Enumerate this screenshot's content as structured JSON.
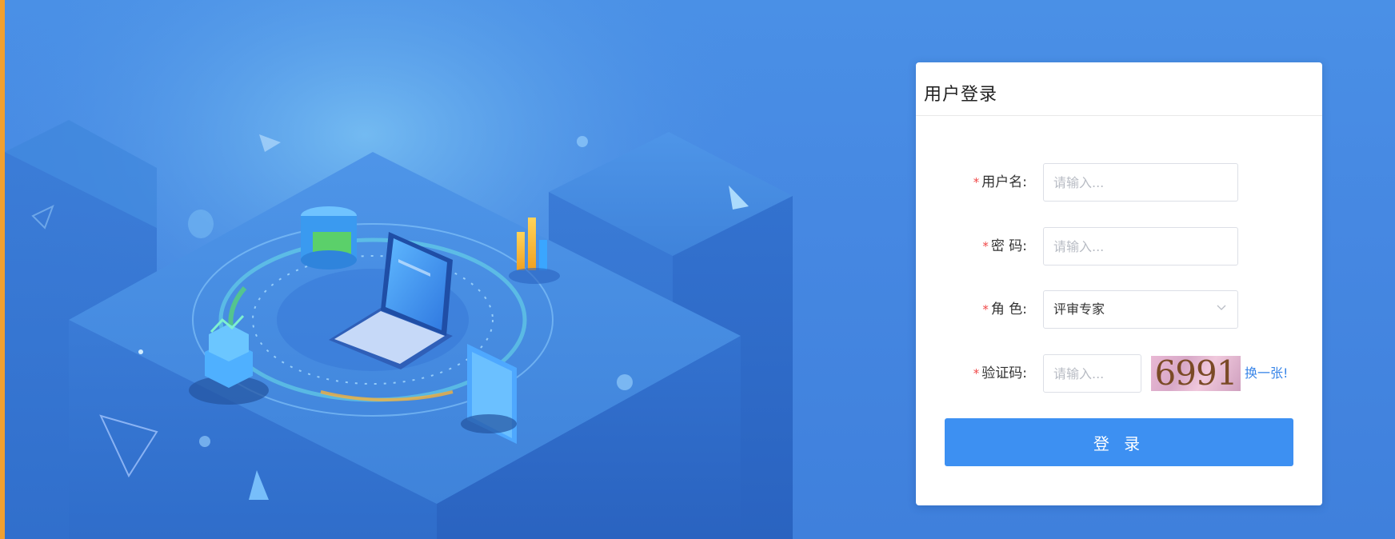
{
  "login": {
    "title": "用户登录",
    "username": {
      "label": "用户名:",
      "placeholder": "请输入..."
    },
    "password": {
      "label": "密 码:",
      "placeholder": "请输入..."
    },
    "role": {
      "label": "角 色:",
      "value": "评审专家"
    },
    "captcha": {
      "label": "验证码:",
      "placeholder": "请输入...",
      "code": "6991",
      "refresh_label": "换一张!"
    },
    "submit_label": "登 录",
    "required_mark": "*"
  },
  "colors": {
    "background": "#4688e2",
    "accent": "#3d90f2",
    "required": "#f04848",
    "link": "#3a86e8",
    "left_border": "#f0a030"
  },
  "icons": {
    "select_arrow": "chevron-down-icon"
  }
}
